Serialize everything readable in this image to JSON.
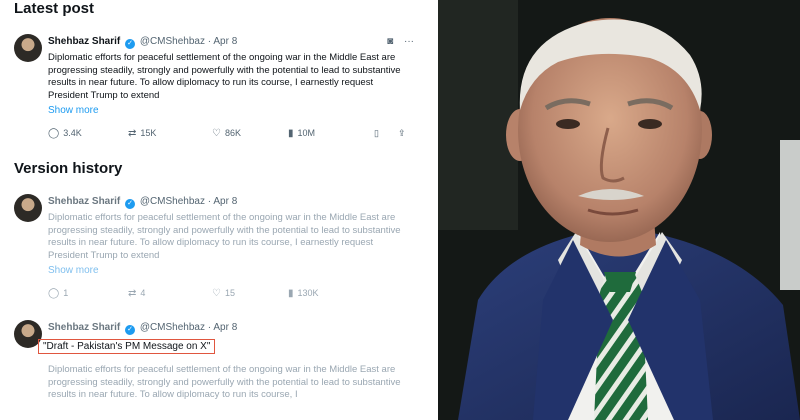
{
  "latest": {
    "title": "Latest post",
    "tweet": {
      "name": "Shehbaz Sharif",
      "handle": "@CMShehbaz",
      "dot": "·",
      "date": "Apr 8",
      "body": "Diplomatic efforts for peaceful settlement of the ongoing war in the Middle East are progressing steadily, strongly and powerfully with the potential to lead to substantive results in near future. To allow diplomacy to run its course, I earnestly request President Trump to extend",
      "show_more": "Show more",
      "replies": "3.4K",
      "reposts": "15K",
      "likes": "86K",
      "views": "10M"
    }
  },
  "history": {
    "title": "Version history",
    "v1": {
      "name": "Shehbaz Sharif",
      "handle": "@CMShehbaz",
      "dot": "·",
      "date": "Apr 8",
      "body": "Diplomatic efforts for peaceful settlement of the ongoing war in the Middle East are progressing steadily, strongly and powerfully with the potential to lead to substantive results in near future. To allow diplomacy to run its course, I earnestly request President Trump to extend",
      "show_more": "Show more",
      "replies": "1",
      "reposts": "4",
      "likes": "15",
      "views": "130K"
    },
    "v2": {
      "name": "Shehbaz Sharif",
      "handle": "@CMShehbaz",
      "dot": "·",
      "date": "Apr 8",
      "draft": "\"Draft - Pakistan's PM Message on X\"",
      "body": "Diplomatic efforts for peaceful settlement of the ongoing war in the Middle East are progressing steadily, strongly and powerfully with the potential to lead to substantive results in near future. To allow diplomacy to run its course, I"
    }
  },
  "icons": {
    "verified": "verified-badge-icon",
    "grok": "grok-icon",
    "more": "more-icon",
    "reply": "reply-icon",
    "repost": "repost-icon",
    "like": "like-icon",
    "views": "views-icon",
    "bookmark": "bookmark-icon",
    "share": "share-icon"
  },
  "colors": {
    "accent": "#1d9bf0",
    "highlight": "#e0563f",
    "suit": "#24356b",
    "tie": "#1f6b3c"
  }
}
